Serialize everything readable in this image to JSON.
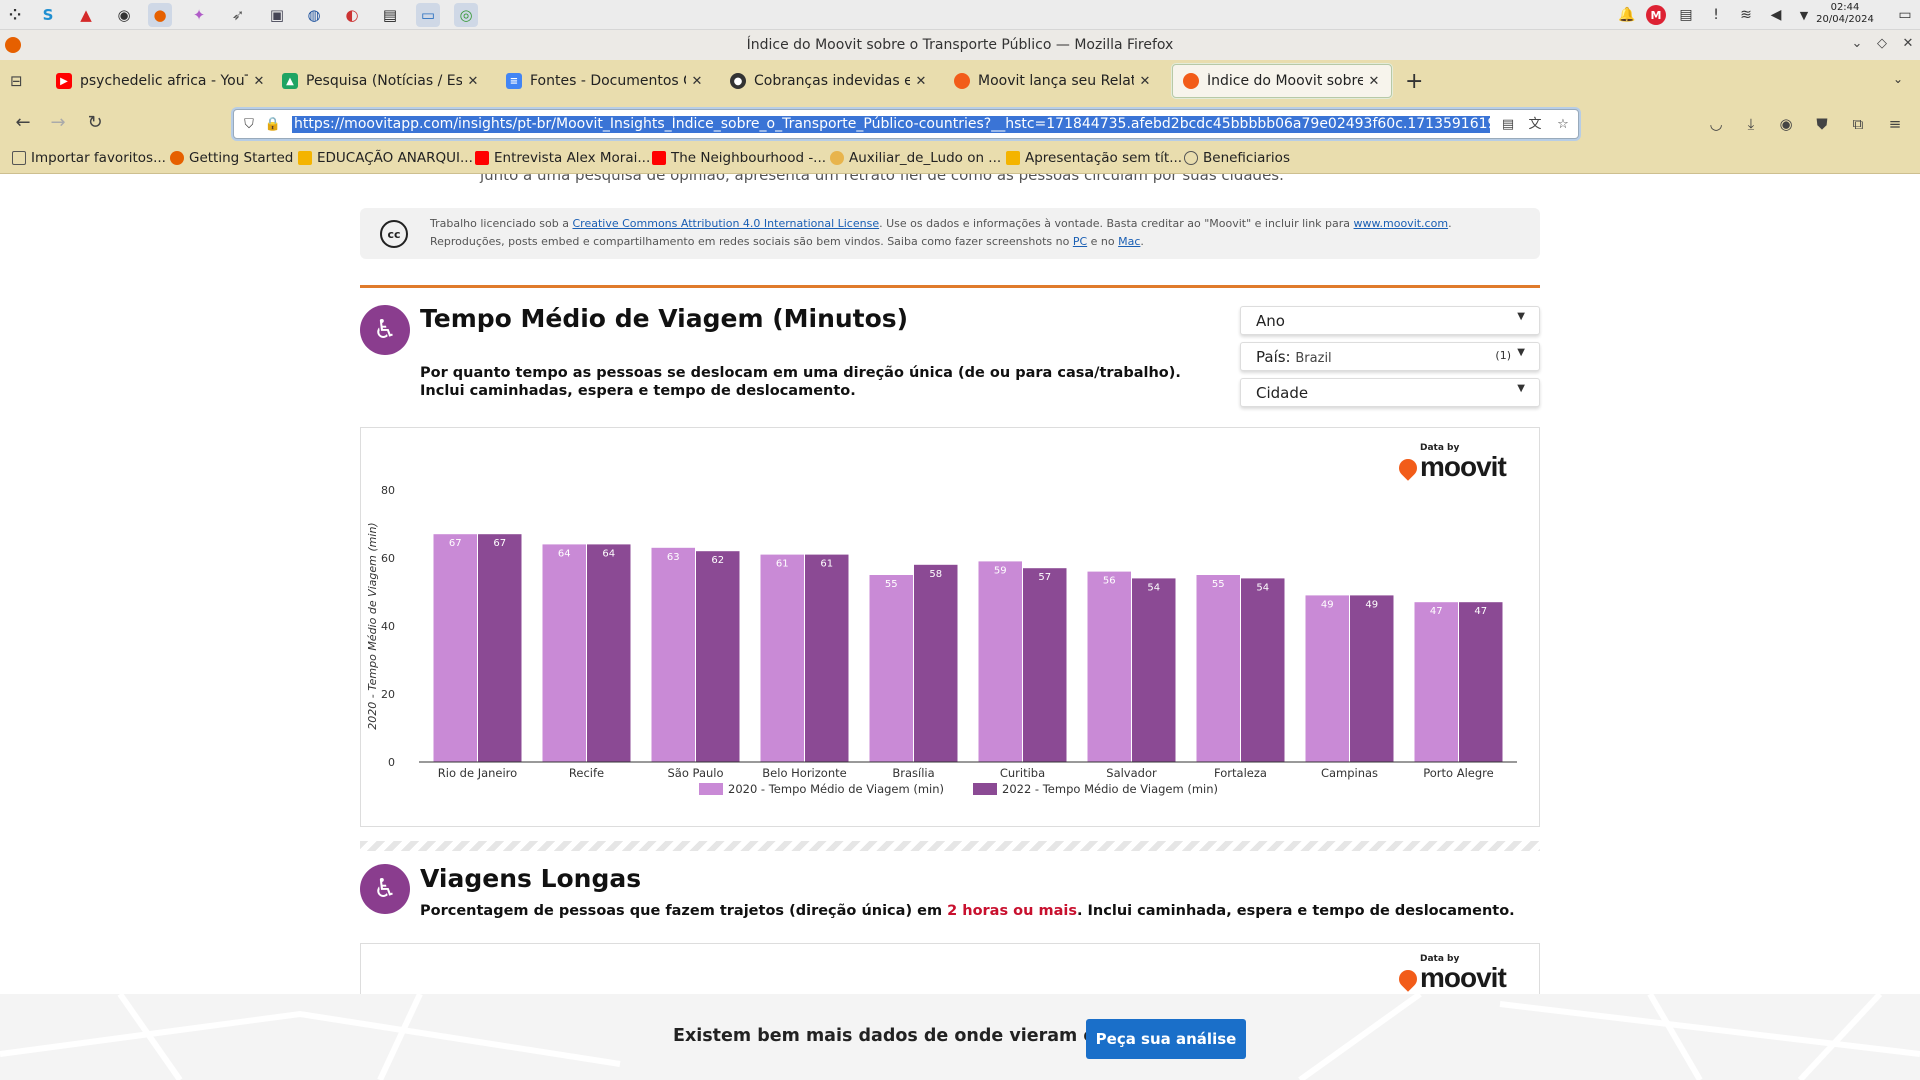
{
  "taskbar": {
    "clock_time": "02:44",
    "clock_date": "20/04/2024"
  },
  "window": {
    "title": "Índice do Moovit sobre o Transporte Público — Mozilla Firefox"
  },
  "tabs": [
    {
      "label": "psychedelic africa - YouTube",
      "icon": "youtube-icon",
      "color": "#ff0000"
    },
    {
      "label": "Pesquisa (Notícias / Estatísticas)",
      "icon": "drive-icon",
      "color": "#1fa463"
    },
    {
      "label": "Fontes - Documentos Google",
      "icon": "docs-icon",
      "color": "#4285f4"
    },
    {
      "label": "Cobranças indevidas e atrasos",
      "icon": "github-icon",
      "color": "#333333"
    },
    {
      "label": "Moovit lança seu Relatório",
      "icon": "moovit-icon",
      "color": "#f25c19"
    },
    {
      "label": "Índice do Moovit sobre o Transporte Público",
      "icon": "moovit-icon",
      "color": "#f25c19"
    }
  ],
  "url": "https://moovitapp.com/insights/pt-br/Moovit_Insights_Índice_sobre_o_Transporte_Público-countries?__hstc=171844735.afebd2bcdc45bbbbb06a79e02493f60c.1713591619721.1713591",
  "bookmarks": [
    {
      "label": "Importar favoritos...",
      "icon": "import-icon"
    },
    {
      "label": "Getting Started",
      "icon": "firefox-icon"
    },
    {
      "label": "EDUCAÇÃO ANARQUI...",
      "icon": "slides-icon"
    },
    {
      "label": "Entrevista Alex Morai...",
      "icon": "youtube-icon"
    },
    {
      "label": "The Neighbourhood -...",
      "icon": "youtube-icon"
    },
    {
      "label": "Auxiliar_de_Ludo on ...",
      "icon": "patreon-icon"
    },
    {
      "label": "Apresentação sem tít...",
      "icon": "slides-icon"
    },
    {
      "label": "Beneficiarios",
      "icon": "globe-icon"
    }
  ],
  "page": {
    "cut_text": "junto a uma pesquisa de opinião, apresenta um retrato fiel de como as pessoas circulam por suas cidades.",
    "license": {
      "line1_pre": "Trabalho licenciado sob a ",
      "line1_link": "Creative Commons Attribution 4.0 International License",
      "line1_mid": ". Use os dados e informações à vontade. Basta creditar ao \"Moovit\" e incluir link para ",
      "line1_link2": "www.moovit.com",
      "line1_end": ".",
      "line2_pre": "Reproduções, posts embed e compartilhamento em redes sociais são bem vindos. Saiba como fazer screenshots no ",
      "line2_link1": "PC",
      "line2_mid": " e no ",
      "line2_link2": "Mac",
      "line2_end": "."
    },
    "section1": {
      "title": "Tempo Médio de Viagem (Minutos)",
      "desc_line1": "Por quanto tempo as pessoas se deslocam em uma direção única (de ou para casa/trabalho).",
      "desc_line2": "Inclui caminhadas, espera e tempo de deslocamento."
    },
    "filters": {
      "ano": "Ano",
      "pais_label": "País:",
      "pais_value": "Brazil",
      "pais_count": "(1)",
      "cidade": "Cidade"
    },
    "logo": {
      "by": "Data by",
      "word": "moovit"
    },
    "section2": {
      "title": "Viagens Longas",
      "desc_pre": "Porcentagem de pessoas que fazem trajetos (direção única) em ",
      "desc_hl": "2 horas ou mais",
      "desc_post": ". Inclui caminhada, espera e tempo de deslocamento."
    }
  },
  "chart_data": {
    "type": "bar",
    "categories": [
      "Rio de Janeiro",
      "Recife",
      "São Paulo",
      "Belo Horizonte",
      "Brasília",
      "Curitiba",
      "Salvador",
      "Fortaleza",
      "Campinas",
      "Porto Alegre"
    ],
    "series": [
      {
        "name": "2020 - Tempo Médio de Viagem (min)",
        "color": "#c98ad6",
        "values": [
          67,
          64,
          63,
          61,
          55,
          59,
          56,
          55,
          49,
          47
        ]
      },
      {
        "name": "2022 - Tempo Médio de Viagem (min)",
        "color": "#8b4a94",
        "values": [
          67,
          64,
          62,
          61,
          58,
          57,
          54,
          54,
          49,
          47
        ]
      }
    ],
    "ylabel": "2020 - Tempo Médio de Viagem (min)",
    "yticks": [
      0,
      20,
      40,
      60,
      80
    ],
    "ylim": [
      0,
      80
    ],
    "grid": false,
    "legend": "bottom"
  },
  "banner": {
    "text": "Existem bem mais dados de onde vieram estes",
    "button": "Peça sua análise"
  }
}
